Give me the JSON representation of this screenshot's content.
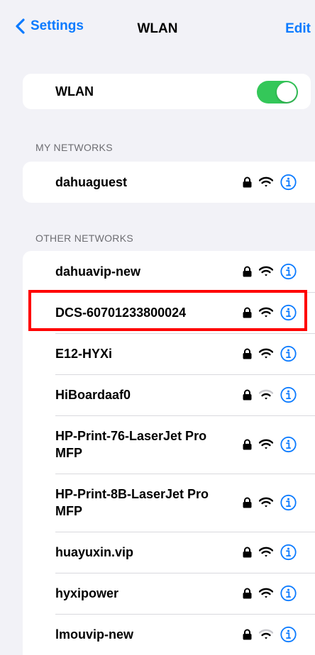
{
  "nav": {
    "back_label": "Settings",
    "title": "WLAN",
    "edit_label": "Edit"
  },
  "wlan_toggle": {
    "label": "WLAN",
    "state": "on",
    "color": "#34c759"
  },
  "my_networks": {
    "header": "MY NETWORKS",
    "items": [
      {
        "name": "dahuaguest",
        "signal": "full",
        "secured": true
      }
    ]
  },
  "other_networks": {
    "header": "OTHER NETWORKS",
    "items": [
      {
        "name": "dahuavip-new",
        "signal": "full",
        "secured": true
      },
      {
        "name": "DCS-60701233800024",
        "signal": "full",
        "secured": true,
        "highlighted": true
      },
      {
        "name": "E12-HYXi",
        "signal": "full",
        "secured": true
      },
      {
        "name": "HiBoardaaf0",
        "signal": "weak",
        "secured": true
      },
      {
        "name": "HP-Print-76-LaserJet Pro MFP",
        "signal": "full",
        "secured": true
      },
      {
        "name": "HP-Print-8B-LaserJet Pro MFP",
        "signal": "full",
        "secured": true
      },
      {
        "name": "huayuxin.vip",
        "signal": "full",
        "secured": true
      },
      {
        "name": "hyxipower",
        "signal": "full",
        "secured": true
      },
      {
        "name": "lmouvip-new",
        "signal": "weak",
        "secured": true
      }
    ]
  },
  "colors": {
    "accent": "#0a7aff",
    "highlight_border": "#ff0000",
    "background": "#f2f2f7"
  },
  "icons": [
    "chevron-left-icon",
    "lock-icon",
    "wifi-icon",
    "info-icon"
  ]
}
